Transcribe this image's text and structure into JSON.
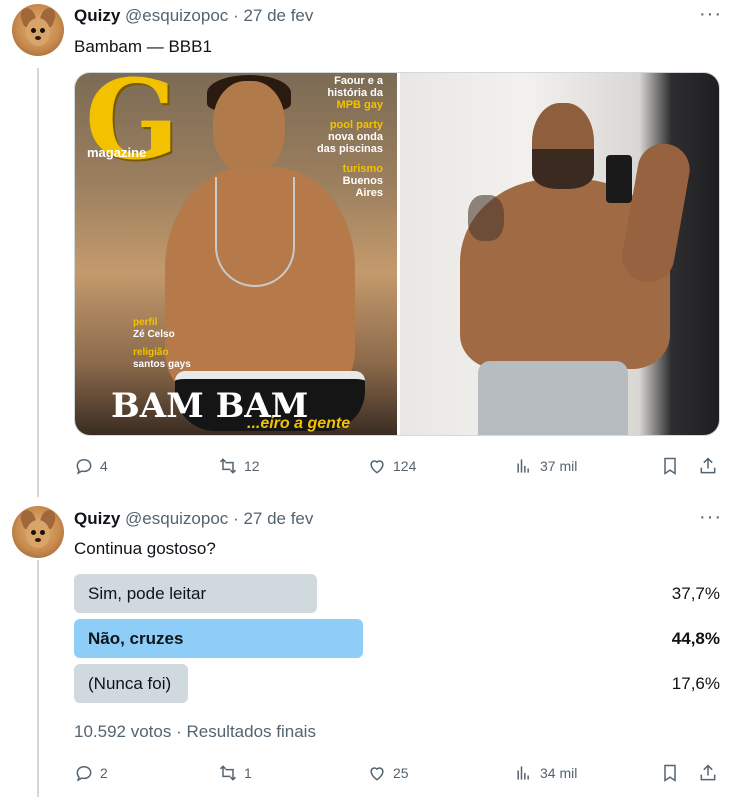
{
  "tweet1": {
    "name": "Quizy",
    "handle": "@esquizopoc",
    "separator": "·",
    "date": "27 de fev",
    "text": "Bambam — BBB1",
    "media": {
      "magazine_letter": "G",
      "magazine_word": "magazine",
      "cover_lines_right": [
        "Faour e a",
        "história da",
        "MPB gay",
        "pool party",
        "nova onda",
        "das piscinas",
        "turismo",
        "Buenos",
        "Aires"
      ],
      "cover_lines_left": [
        "perfil",
        "Zé Celso",
        "religião",
        "santos gays"
      ],
      "cover_big": "BAM BAM",
      "cover_tagline": "...eiro a gente"
    },
    "actions": {
      "replies": "4",
      "retweets": "12",
      "likes": "124",
      "views": "37 mil"
    }
  },
  "tweet2": {
    "name": "Quizy",
    "handle": "@esquizopoc",
    "separator": "·",
    "date": "27 de fev",
    "text": "Continua gostoso?",
    "poll": {
      "options": [
        {
          "label": "Sim, pode leitar",
          "percent": "37,7%",
          "value": 0.377,
          "winner": false
        },
        {
          "label": "Não, cruzes",
          "percent": "44,8%",
          "value": 0.448,
          "winner": true
        },
        {
          "label": "(Nunca foi)",
          "percent": "17,6%",
          "value": 0.176,
          "winner": false
        }
      ],
      "votes": "10.592 votos",
      "separator": "·",
      "status": "Resultados finais"
    },
    "actions": {
      "replies": "2",
      "retweets": "1",
      "likes": "25",
      "views": "34 mil"
    }
  },
  "icons": [
    "more-icon",
    "reply-icon",
    "retweet-icon",
    "like-icon",
    "views-icon",
    "bookmark-icon",
    "share-icon"
  ]
}
